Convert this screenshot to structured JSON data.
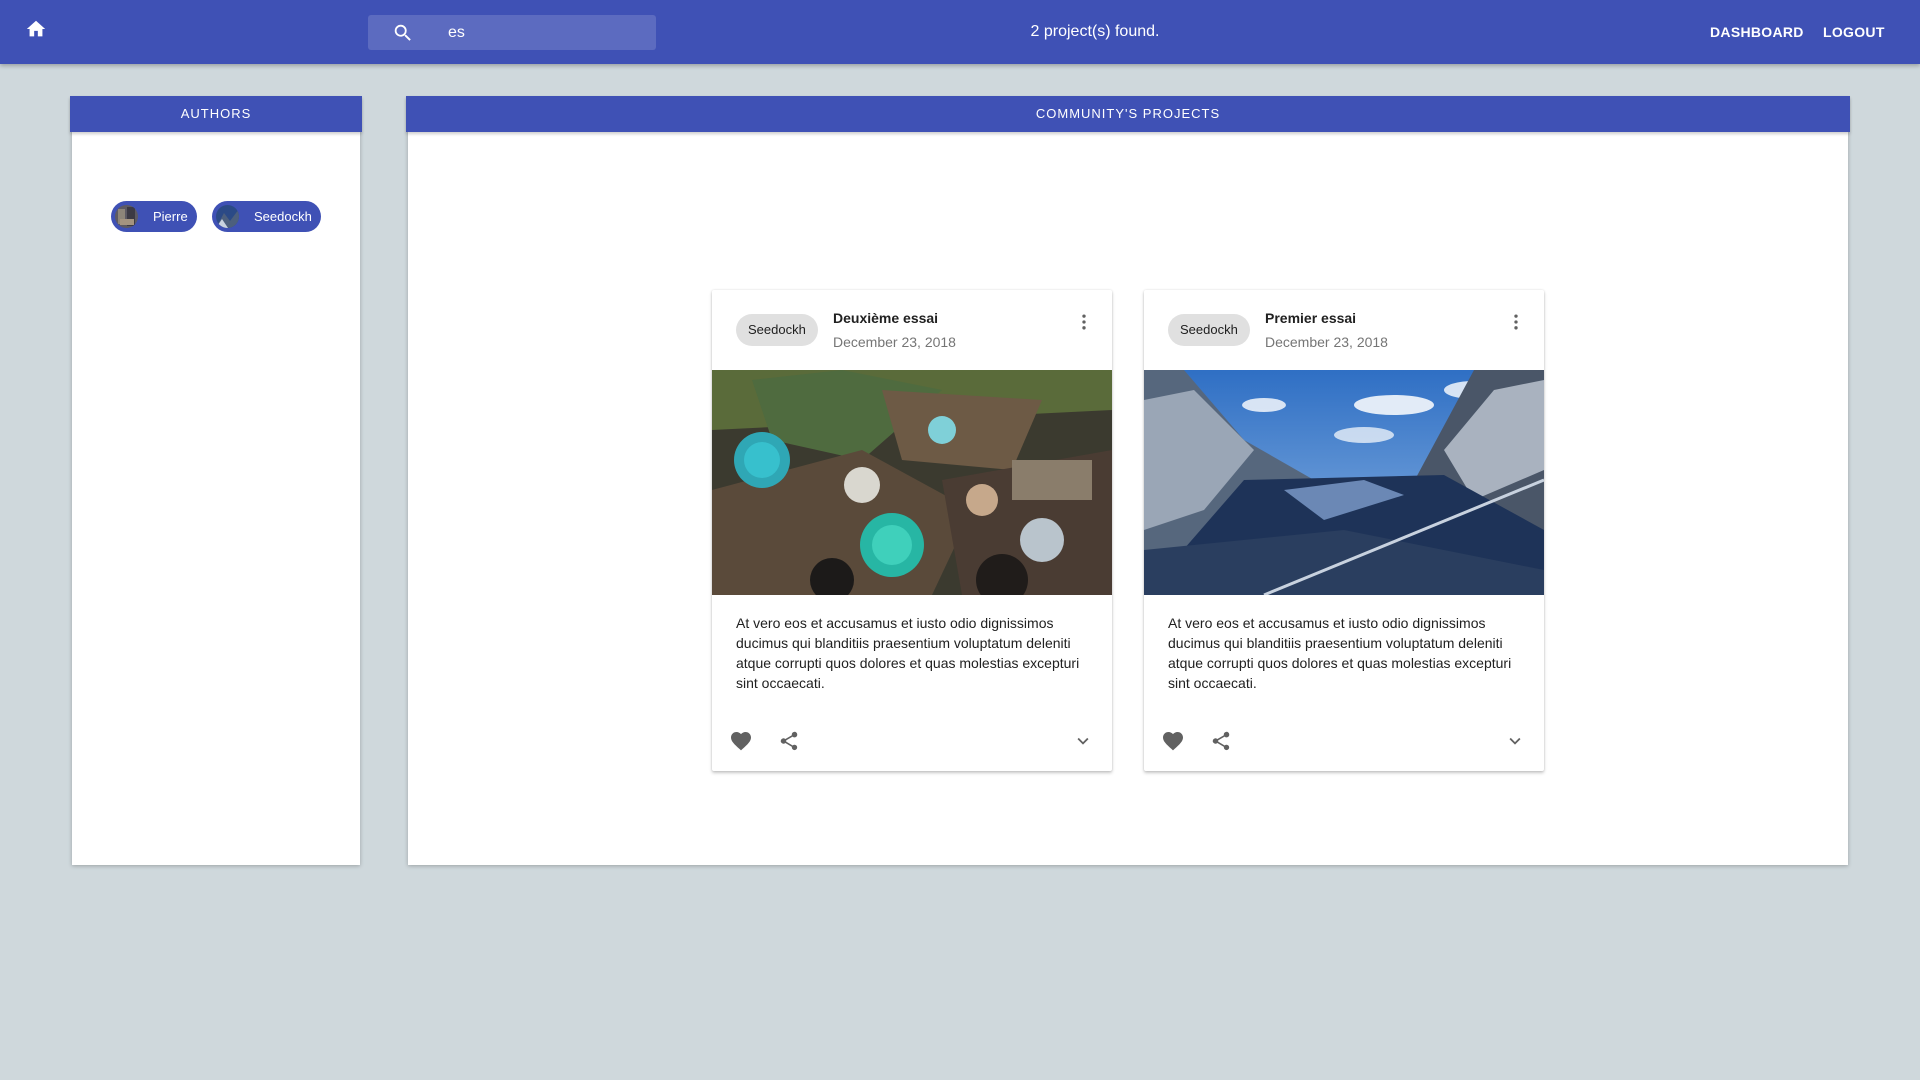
{
  "appbar": {
    "search_value": "es",
    "result_text": "2 project(s) found.",
    "nav": [
      "DASHBOARD",
      "LOGOUT"
    ],
    "color": "#3f51b5",
    "icons": {
      "home": "home-icon",
      "search": "search-icon"
    }
  },
  "authors": {
    "header": "AUTHORS",
    "chips": [
      {
        "name": "Pierre"
      },
      {
        "name": "Seedockh"
      }
    ]
  },
  "projects": {
    "header": "COMMUNITY'S PROJECTS",
    "cards": [
      {
        "author": "Seedockh",
        "title": "Deuxième essai",
        "date": "December 23, 2018",
        "text": "At vero eos et accusamus et iusto odio dignissimos ducimus qui blanditiis praesentium voluptatum deleniti atque corrupti quos dolores et quas molestias excepturi sint occaecati.",
        "image": "floating-market-photo"
      },
      {
        "author": "Seedockh",
        "title": "Premier essai",
        "date": "December 23, 2018",
        "text": "At vero eos et accusamus et iusto odio dignissimos ducimus qui blanditiis praesentium voluptatum deleniti atque corrupti quos dolores et quas molestias excepturi sint occaecati.",
        "image": "mountain-landscape-photo"
      }
    ],
    "card_icons": [
      "more-vert-icon",
      "heart-icon",
      "share-icon",
      "chevron-down-icon"
    ]
  }
}
